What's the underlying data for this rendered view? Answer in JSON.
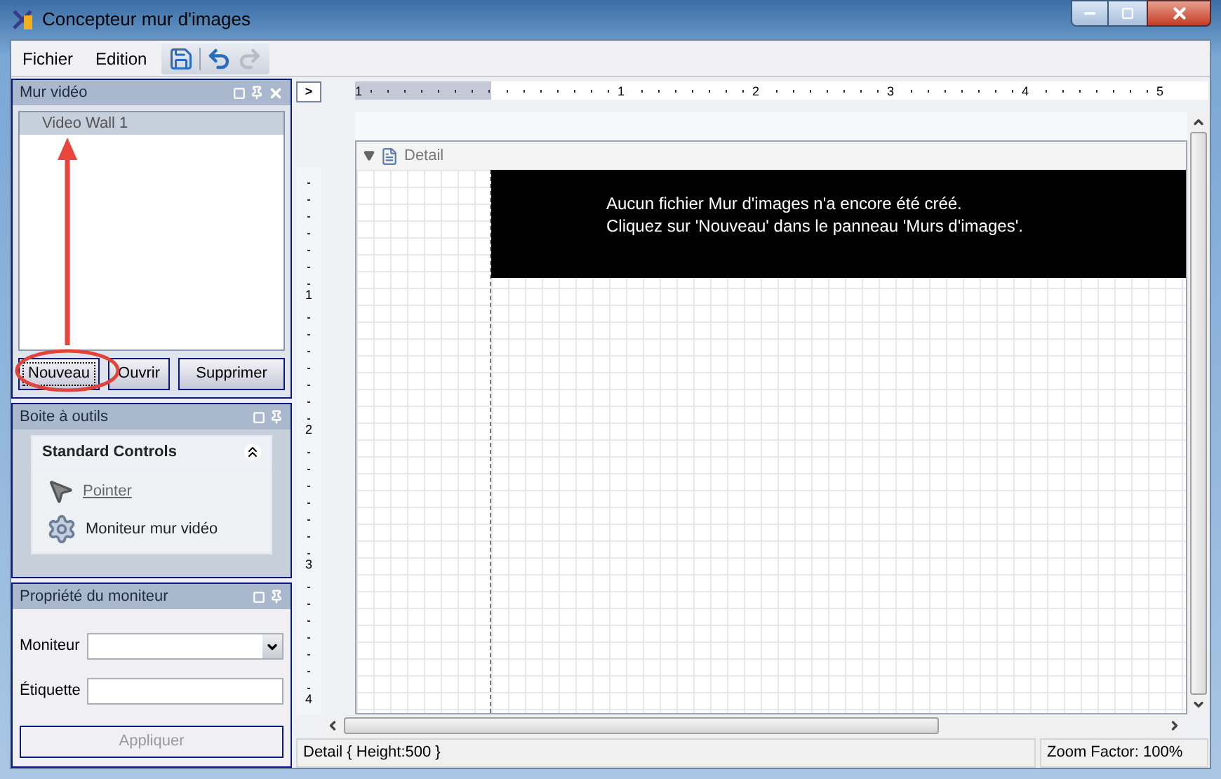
{
  "window": {
    "title": "Concepteur mur d'images"
  },
  "menu": [
    {
      "label": "Fichier"
    },
    {
      "label": "Edition"
    }
  ],
  "toolbar": [
    {
      "kind": "save",
      "disabled": false
    },
    {
      "kind": "undo",
      "disabled": false
    },
    {
      "kind": "redo",
      "disabled": true
    }
  ],
  "video_wall_panel": {
    "title": "Mur vidéo",
    "items": [
      {
        "label": "Video Wall 1",
        "selected": true
      }
    ],
    "buttons": [
      {
        "label": "Nouveau",
        "focused": true
      },
      {
        "label": "Ouvrir",
        "focused": false
      },
      {
        "label": "Supprimer",
        "focused": false
      }
    ]
  },
  "toolbox_panel": {
    "title": "Boite à outils",
    "group": {
      "title": "Standard Controls",
      "expanded": true
    },
    "items": [
      {
        "kind": "pointer",
        "label": "Pointer",
        "link": true
      },
      {
        "kind": "monitor",
        "label": "Moniteur mur vidéo",
        "link": false
      }
    ]
  },
  "properties_panel": {
    "title": "Propriété du moniteur",
    "fields": [
      {
        "kind": "select",
        "label": "Moniteur"
      },
      {
        "kind": "text",
        "label": "Étiquette"
      }
    ],
    "apply_button": {
      "label": "Appliquer",
      "disabled": true
    }
  },
  "designer": {
    "toggle": ">",
    "ruler_margin_label": "1",
    "horizontal_ruler": [
      "1",
      "2",
      "3",
      "4",
      "5"
    ],
    "vertical_ruler": [
      "1",
      "2",
      "3",
      "4"
    ],
    "band": {
      "title": "Detail",
      "expanded": true
    },
    "message": [
      "Aucun fichier Mur d'images n'a encore été créé.",
      "Cliquez sur 'Nouveau' dans le panneau 'Murs d'images'."
    ]
  },
  "status_bar": [
    "Detail { Height:500 }",
    "Zoom Factor: 100%"
  ]
}
